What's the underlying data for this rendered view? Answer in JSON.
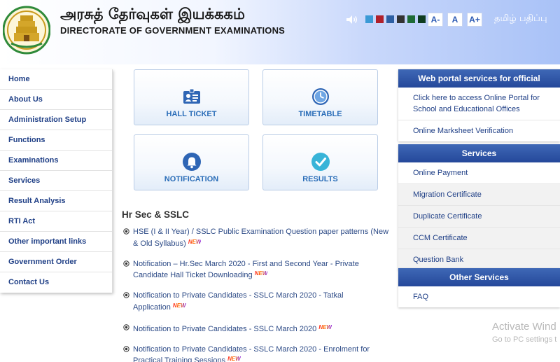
{
  "header": {
    "title_tamil": "அரசுத் தேர்வுகள் இயக்ககம்",
    "title_english": "DIRECTORATE OF GOVERNMENT EXAMINATIONS",
    "theme_colors": [
      "#3b9ad6",
      "#b0202b",
      "#2d5fa3",
      "#333333",
      "#1e6b36",
      "#0f3d20"
    ],
    "font_buttons": [
      "A-",
      "A",
      "A+"
    ],
    "tamil_edition": "தமிழ் பதிப்பு"
  },
  "left_menu": [
    "Home",
    "About Us",
    "Administration Setup",
    "Functions",
    "Examinations",
    "Services",
    "Result Analysis",
    "RTI Act",
    "Other important links",
    "Government Order",
    "Contact Us"
  ],
  "tiles": [
    {
      "label": "HALL TICKET",
      "icon": "id-card-icon"
    },
    {
      "label": "TIMETABLE",
      "icon": "clock-icon"
    },
    {
      "label": "NOTIFICATION",
      "icon": "bell-icon"
    },
    {
      "label": "RESULTS",
      "icon": "check-circle-icon"
    }
  ],
  "section_title": "Hr Sec & SSLC",
  "new_badge": "NEW",
  "news": [
    {
      "text": "HSE (I & II Year) / SSLC Public Examination Question paper patterns (New & Old Syllabus)"
    },
    {
      "text": "Notification – Hr.Sec March 2020 - First and Second Year - Private Candidate Hall Ticket Downloading"
    },
    {
      "text": "Notification to Private Candidates - SSLC March 2020 - Tatkal Application"
    },
    {
      "text": "Notification to Private Candidates - SSLC March 2020"
    },
    {
      "text": "Notification to Private Candidates - SSLC March 2020 - Enrolment for Practical Training Sessions"
    }
  ],
  "panel_official": {
    "title": "Web portal services for official",
    "items": [
      "Click here to access Online Portal for School and Educational Offices",
      "Online Marksheet Verification"
    ]
  },
  "panel_services": {
    "title": "Services",
    "items": [
      "Online Payment",
      "Migration Certificate",
      "Duplicate Certificate",
      "CCM Certificate",
      "Question Bank"
    ]
  },
  "panel_other": {
    "title": "Other Services",
    "items": [
      "FAQ"
    ]
  },
  "watermark": {
    "line1": "Activate Wind",
    "line2": "Go to PC settings t"
  }
}
